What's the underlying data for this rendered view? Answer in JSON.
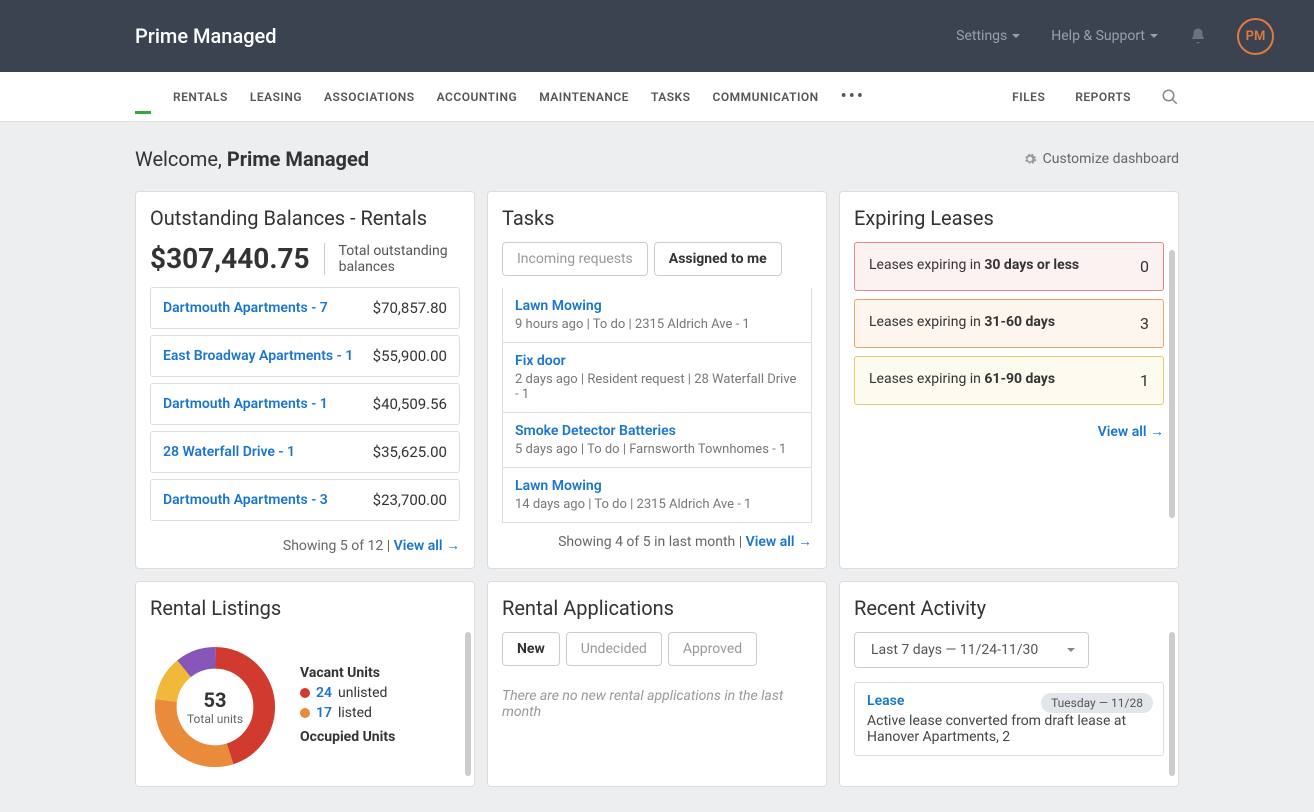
{
  "brand": "Prime Managed",
  "topnav": {
    "settings": "Settings",
    "help": "Help & Support",
    "avatar": "PM"
  },
  "nav": {
    "items": [
      "RENTALS",
      "LEASING",
      "ASSOCIATIONS",
      "ACCOUNTING",
      "MAINTENANCE",
      "TASKS",
      "COMMUNICATION"
    ],
    "files": "FILES",
    "reports": "REPORTS"
  },
  "welcome": {
    "prefix": "Welcome, ",
    "name": "Prime Managed"
  },
  "customize": "Customize dashboard",
  "balances": {
    "title": "Outstanding Balances - Rentals",
    "total": "$307,440.75",
    "total_label": "Total outstanding balances",
    "items": [
      {
        "name": "Dartmouth Apartments - 7",
        "amt": "$70,857.80"
      },
      {
        "name": "East Broadway Apartments - 1",
        "amt": "$55,900.00"
      },
      {
        "name": "Dartmouth Apartments - 1",
        "amt": "$40,509.56"
      },
      {
        "name": "28 Waterfall Drive - 1",
        "amt": "$35,625.00"
      },
      {
        "name": "Dartmouth Apartments - 3",
        "amt": "$23,700.00"
      }
    ],
    "footer": "Showing 5 of 12  |  ",
    "view_all": "View all →"
  },
  "tasks": {
    "title": "Tasks",
    "tabs": {
      "incoming": "Incoming requests",
      "assigned": "Assigned to me"
    },
    "items": [
      {
        "title": "Lawn Mowing",
        "meta": "9 hours ago | To do | 2315 Aldrich Ave - 1"
      },
      {
        "title": "Fix door",
        "meta": "2 days ago | Resident request | 28 Waterfall Drive - 1"
      },
      {
        "title": "Smoke Detector Batteries",
        "meta": "5 days ago | To do | Farnsworth Townhomes - 1"
      },
      {
        "title": "Lawn Mowing",
        "meta": "14 days ago | To do | 2315 Aldrich Ave - 1"
      }
    ],
    "footer": "Showing 4 of 5 in last month  |  ",
    "view_all": "View all →"
  },
  "expiring": {
    "title": "Expiring Leases",
    "items": [
      {
        "label_pre": "Leases expiring in ",
        "label_bold": "30 days or less",
        "count": "0"
      },
      {
        "label_pre": "Leases expiring in ",
        "label_bold": "31-60 days",
        "count": "3"
      },
      {
        "label_pre": "Leases expiring in ",
        "label_bold": "61-90 days",
        "count": "1"
      }
    ],
    "view_all": "View all →"
  },
  "listings": {
    "title": "Rental Listings",
    "center_num": "53",
    "center_txt": "Total units",
    "vacant": {
      "heading": "Vacant Units",
      "unlisted_n": "24",
      "unlisted_t": "unlisted",
      "listed_n": "17",
      "listed_t": "listed"
    },
    "occupied_heading": "Occupied Units"
  },
  "applications": {
    "title": "Rental Applications",
    "tabs": {
      "new": "New",
      "undecided": "Undecided",
      "approved": "Approved"
    },
    "empty": "There are no new rental applications in the last month"
  },
  "activity": {
    "title": "Recent Activity",
    "range": "Last 7 days — 11/24-11/30",
    "item": {
      "cat": "Lease",
      "badge": "Tuesday — 11/28",
      "desc": "Active lease converted from draft lease at Hanover Apartments, 2"
    }
  },
  "chart_data": {
    "type": "pie",
    "title": "Rental Listings",
    "series": [
      {
        "name": "Unlisted vacant",
        "value": 24,
        "color": "#d13a2f"
      },
      {
        "name": "Listed vacant",
        "value": 17,
        "color": "#e98b3b"
      },
      {
        "name": "Occupied (segment A)",
        "value": 6,
        "color": "#f1b93a"
      },
      {
        "name": "Occupied (segment B)",
        "value": 6,
        "color": "#8756b8"
      }
    ],
    "center_value": 53,
    "center_label": "Total units"
  }
}
